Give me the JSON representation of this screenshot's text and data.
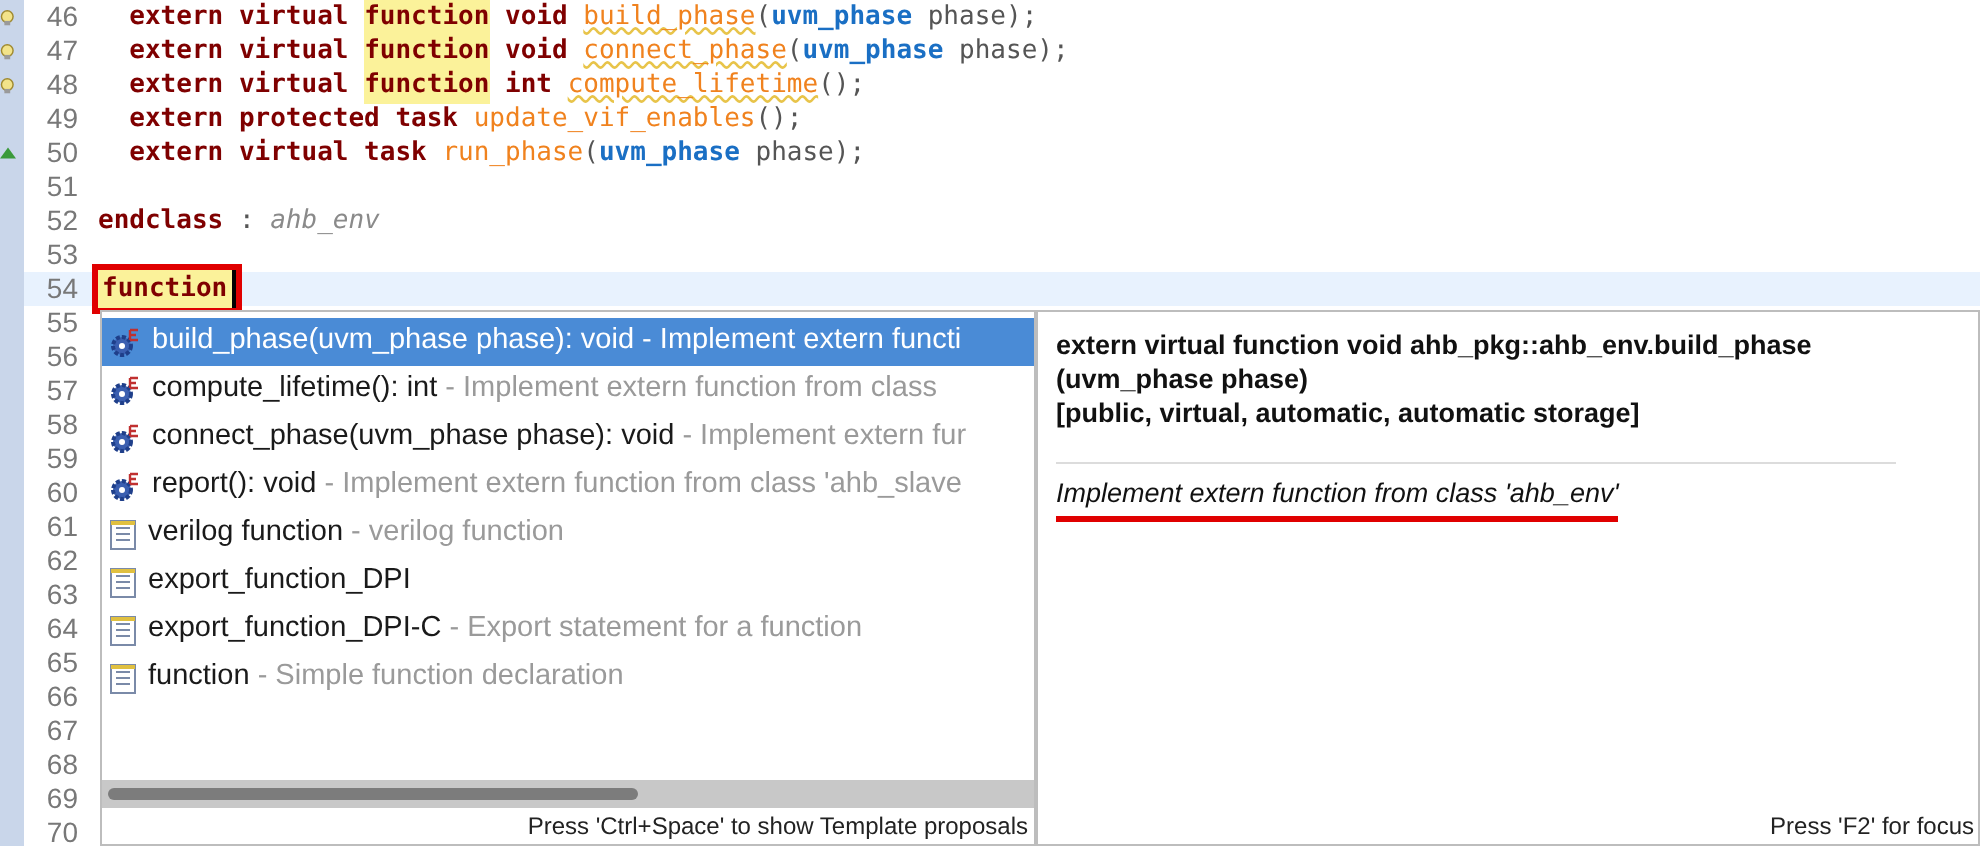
{
  "editor": {
    "lines": [
      {
        "number": "46",
        "kind": "warning",
        "tokens": [
          {
            "kind": "kw",
            "text": "  extern virtual "
          },
          {
            "kind": "hl",
            "text": "function"
          },
          {
            "kind": "kw",
            "text": " void "
          },
          {
            "kind": "fn_warn",
            "text": "build_phase"
          },
          {
            "kind": "plain",
            "text": "("
          },
          {
            "kind": "type",
            "text": "uvm_phase"
          },
          {
            "kind": "plain",
            "text": " phase);"
          }
        ]
      },
      {
        "number": "47",
        "kind": "warning",
        "tokens": [
          {
            "kind": "kw",
            "text": "  extern virtual "
          },
          {
            "kind": "hl",
            "text": "function"
          },
          {
            "kind": "kw",
            "text": " void "
          },
          {
            "kind": "fn_warn",
            "text": "connect_phase"
          },
          {
            "kind": "plain",
            "text": "("
          },
          {
            "kind": "type",
            "text": "uvm_phase"
          },
          {
            "kind": "plain",
            "text": " phase);"
          }
        ]
      },
      {
        "number": "48",
        "kind": "warning",
        "tokens": [
          {
            "kind": "kw",
            "text": "  extern virtual "
          },
          {
            "kind": "hl",
            "text": "function"
          },
          {
            "kind": "kw",
            "text": " int "
          },
          {
            "kind": "fn_warn",
            "text": "compute_lifetime"
          },
          {
            "kind": "plain",
            "text": "();"
          }
        ]
      },
      {
        "number": "49",
        "kind": "plain",
        "tokens": [
          {
            "kind": "kw",
            "text": "  extern protected task "
          },
          {
            "kind": "fn",
            "text": "update_vif_enables"
          },
          {
            "kind": "plain",
            "text": "();"
          }
        ]
      },
      {
        "number": "50",
        "kind": "override",
        "tokens": [
          {
            "kind": "kw",
            "text": "  extern virtual task "
          },
          {
            "kind": "fn",
            "text": "run_phase"
          },
          {
            "kind": "plain",
            "text": "("
          },
          {
            "kind": "type",
            "text": "uvm_phase"
          },
          {
            "kind": "plain",
            "text": " phase);"
          }
        ]
      },
      {
        "number": "51",
        "kind": "plain"
      },
      {
        "number": "52",
        "kind": "plain",
        "tokens": [
          {
            "kind": "kw",
            "text": "endclass"
          },
          {
            "kind": "plain",
            "text": " : "
          },
          {
            "kind": "label",
            "text": "ahb_env"
          }
        ]
      },
      {
        "number": "53",
        "kind": "plain"
      },
      {
        "number": "54",
        "kind": "plain",
        "current": true,
        "tokens": [
          {
            "kind": "typed",
            "text": "function"
          }
        ]
      },
      {
        "number": "55",
        "kind": "plain"
      },
      {
        "number": "56",
        "kind": "plain"
      },
      {
        "number": "57",
        "kind": "plain"
      },
      {
        "number": "58",
        "kind": "plain"
      },
      {
        "number": "59",
        "kind": "plain"
      },
      {
        "number": "60",
        "kind": "plain"
      },
      {
        "number": "61",
        "kind": "plain"
      },
      {
        "number": "62",
        "kind": "plain"
      },
      {
        "number": "63",
        "kind": "plain"
      },
      {
        "number": "64",
        "kind": "plain"
      },
      {
        "number": "65",
        "kind": "plain"
      },
      {
        "number": "66",
        "kind": "plain"
      },
      {
        "number": "67",
        "kind": "plain"
      },
      {
        "number": "68",
        "kind": "plain"
      },
      {
        "number": "69",
        "kind": "plain"
      },
      {
        "number": "70",
        "kind": "plain"
      }
    ]
  },
  "completion": {
    "proposals": [
      {
        "kind": "method",
        "label": "build_phase(uvm_phase phase): void",
        "description": " - Implement extern functi",
        "selected": true
      },
      {
        "kind": "method",
        "label": "compute_lifetime(): int",
        "description": " - Implement extern function from class",
        "selected": false
      },
      {
        "kind": "method",
        "label": "connect_phase(uvm_phase phase): void",
        "description": " - Implement extern fur",
        "selected": false
      },
      {
        "kind": "method",
        "label": "report(): void",
        "description": " - Implement extern function from class 'ahb_slave",
        "selected": false
      },
      {
        "kind": "template",
        "label": "verilog function",
        "description": " - verilog function",
        "selected": false
      },
      {
        "kind": "template",
        "label": "export_function_DPI",
        "selected": false
      },
      {
        "kind": "template",
        "label": "export_function_DPI-C",
        "description": " - Export statement for a function",
        "selected": false
      },
      {
        "kind": "template",
        "label": "function",
        "description": " - Simple function declaration",
        "selected": false
      }
    ],
    "status": "Press 'Ctrl+Space' to show Template proposals"
  },
  "details": {
    "signature": "extern virtual function void ahb_pkg::ahb_env.build_phase (uvm_phase phase)",
    "attributes": "[public, virtual, automatic, automatic storage]",
    "description": "Implement extern function from class 'ahb_env'",
    "status": "Press 'F2' for focus"
  }
}
